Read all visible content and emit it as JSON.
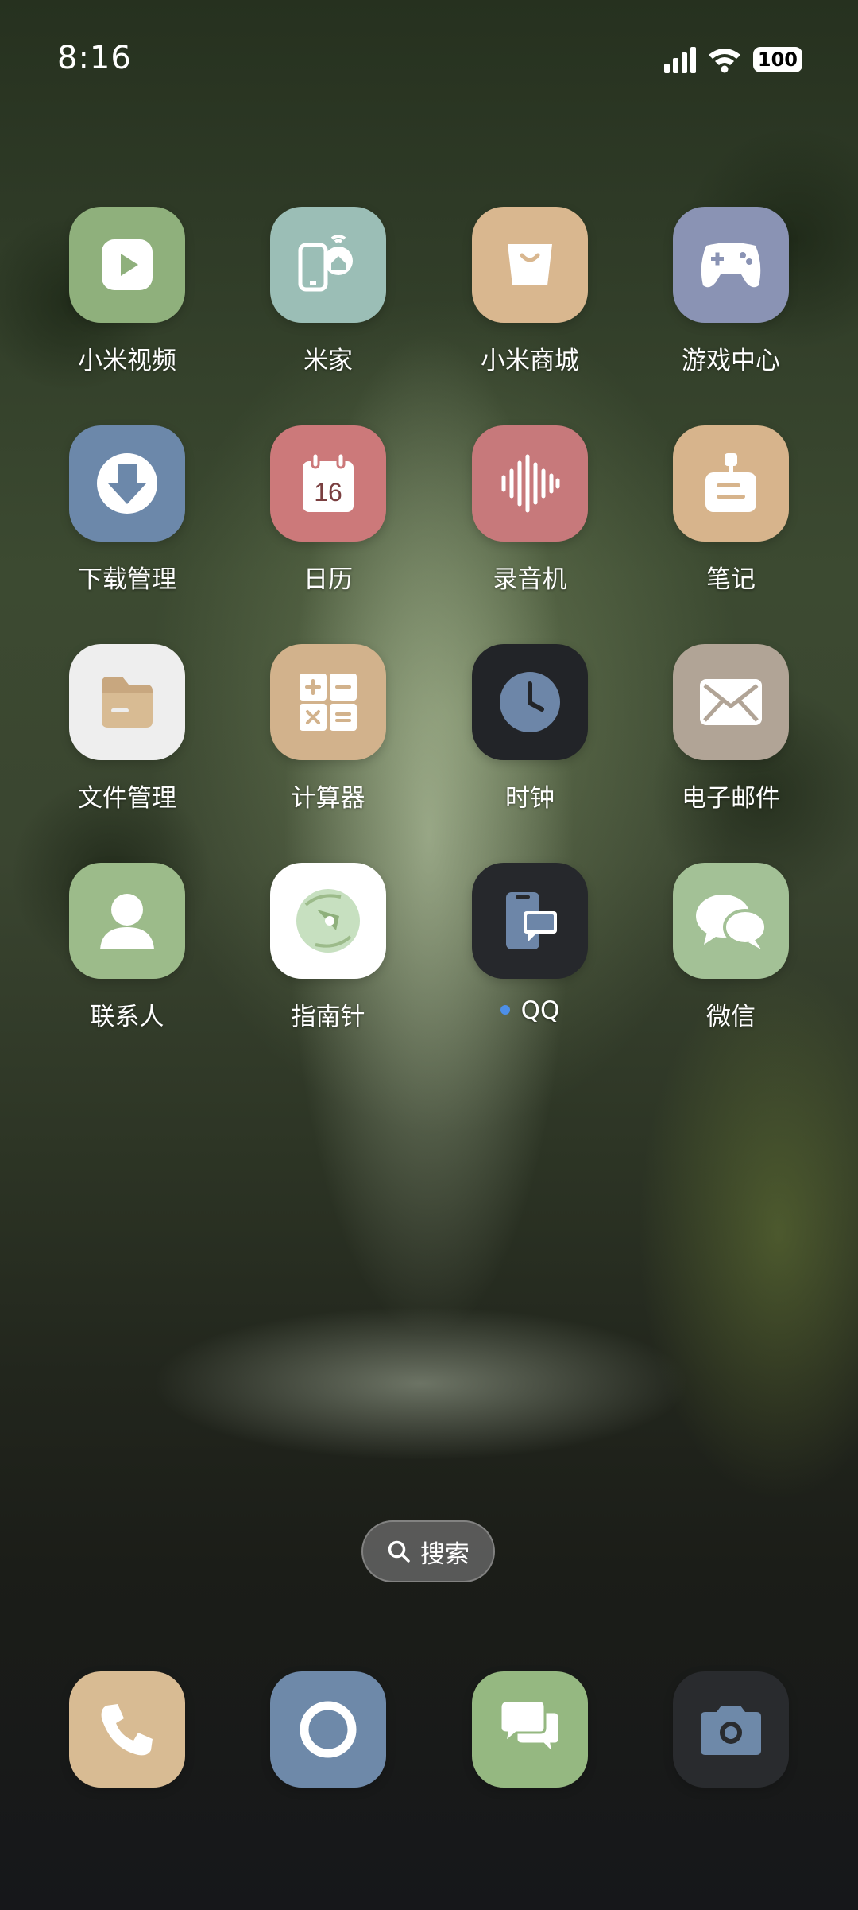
{
  "status_bar": {
    "time": "8:16",
    "battery": "100"
  },
  "apps": [
    {
      "label": "小米视频",
      "icon": "video-play-icon",
      "color": "#8fb07c"
    },
    {
      "label": "米家",
      "icon": "smart-home-icon",
      "color": "#9bbeb6"
    },
    {
      "label": "小米商城",
      "icon": "shopping-bag-icon",
      "color": "#d9b78f"
    },
    {
      "label": "游戏中心",
      "icon": "gamepad-icon",
      "color": "#8a93b4"
    },
    {
      "label": "下载管理",
      "icon": "download-icon",
      "color": "#6c88aa"
    },
    {
      "label": "日历",
      "icon": "calendar-icon",
      "color": "#cc797a",
      "day": "16"
    },
    {
      "label": "录音机",
      "icon": "voice-recorder-icon",
      "color": "#c7797b"
    },
    {
      "label": "笔记",
      "icon": "notes-icon",
      "color": "#d7b48c"
    },
    {
      "label": "文件管理",
      "icon": "folder-icon",
      "color": "#eeeeee"
    },
    {
      "label": "计算器",
      "icon": "calculator-icon",
      "color": "#d2b28c"
    },
    {
      "label": "时钟",
      "icon": "clock-icon",
      "color": "#222428"
    },
    {
      "label": "电子邮件",
      "icon": "mail-icon",
      "color": "#b1a496"
    },
    {
      "label": "联系人",
      "icon": "contact-icon",
      "color": "#9cbb8a"
    },
    {
      "label": "指南针",
      "icon": "compass-icon",
      "color": "#ffffff"
    },
    {
      "label": "QQ",
      "icon": "qq-icon",
      "color": "#26282c",
      "new_badge": true
    },
    {
      "label": "微信",
      "icon": "wechat-icon",
      "color": "#a3c196"
    }
  ],
  "search": {
    "label": "搜索"
  },
  "dock": [
    {
      "icon": "phone-icon",
      "color": "#d8bb93"
    },
    {
      "icon": "browser-icon",
      "color": "#6e89a9"
    },
    {
      "icon": "messages-icon",
      "color": "#95b881"
    },
    {
      "icon": "camera-icon",
      "color": "#292b2e"
    }
  ]
}
